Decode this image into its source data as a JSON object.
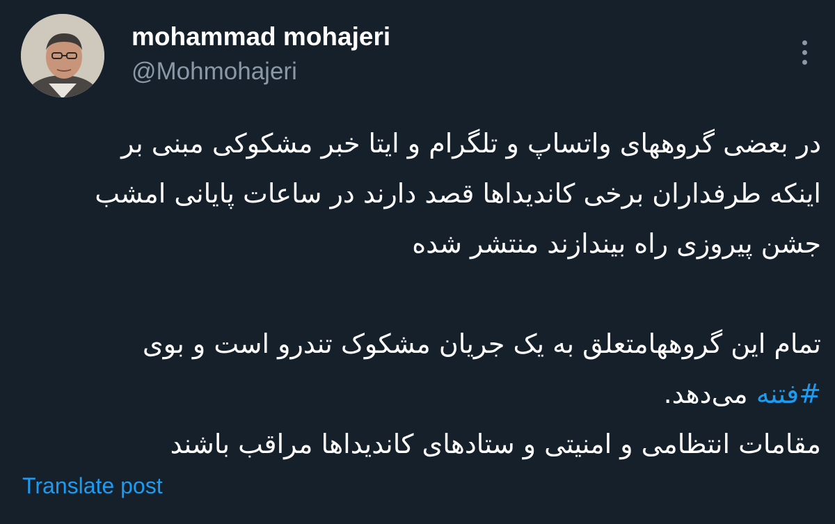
{
  "author": {
    "display_name": "mohammad mohajeri",
    "handle": "@Mohmohajeri",
    "avatar_icon": "person-portrait"
  },
  "menu": {
    "icon": "more-vertical-icon"
  },
  "tweet": {
    "lines": [
      "در بعضی گروههای واتساپ و تلگرام و ایتا خبر مشکوکی مبنی بر",
      "اینکه طرفداران برخی کاندیداها قصد دارند در ساعات پایانی امشب",
      "جشن پیروزی راه بیندازند منتشر شده",
      "",
      "تمام این گروههامتعلق به یک جریان مشکوک تندرو است و بوی",
      "",
      "مقامات انتظامی و امنیتی و ستادهای کاندیداها مراقب باشند"
    ],
    "hashtag": "#فتنه",
    "hashtag_suffix": "می‌دهد."
  },
  "actions": {
    "translate_label": "Translate post"
  },
  "colors": {
    "background": "#15202b",
    "accent": "#1d9bf0",
    "secondary_text": "#8b98a5"
  }
}
